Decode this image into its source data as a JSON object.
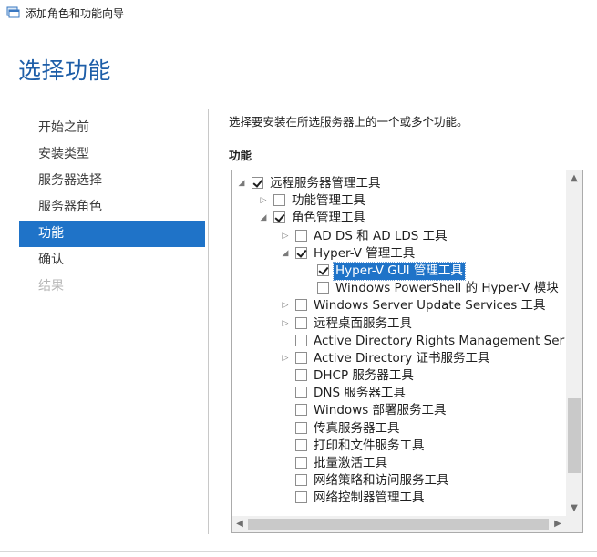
{
  "window": {
    "title": "添加角色和功能向导",
    "icon": "wizard-app-icon"
  },
  "page_title": "选择功能",
  "nav": {
    "items": [
      {
        "label": "开始之前",
        "state": "normal"
      },
      {
        "label": "安装类型",
        "state": "normal"
      },
      {
        "label": "服务器选择",
        "state": "normal"
      },
      {
        "label": "服务器角色",
        "state": "normal"
      },
      {
        "label": "功能",
        "state": "selected"
      },
      {
        "label": "确认",
        "state": "normal"
      },
      {
        "label": "结果",
        "state": "disabled"
      }
    ]
  },
  "main": {
    "description": "选择要安装在所选服务器上的一个或多个功能。",
    "section_label": "功能",
    "tree": [
      {
        "label": "远程服务器管理工具",
        "level": 0,
        "expander": "expanded",
        "checked": true,
        "highlighted": false
      },
      {
        "label": "功能管理工具",
        "level": 1,
        "expander": "collapsed",
        "checked": false,
        "highlighted": false
      },
      {
        "label": "角色管理工具",
        "level": 1,
        "expander": "expanded",
        "checked": true,
        "highlighted": false
      },
      {
        "label": "AD DS 和 AD LDS 工具",
        "level": 2,
        "expander": "collapsed",
        "checked": false,
        "highlighted": false
      },
      {
        "label": "Hyper-V 管理工具",
        "level": 2,
        "expander": "expanded",
        "checked": true,
        "highlighted": false
      },
      {
        "label": "Hyper-V GUI 管理工具",
        "level": 3,
        "expander": "none",
        "checked": true,
        "highlighted": true
      },
      {
        "label": "Windows PowerShell 的 Hyper-V 模块",
        "level": 3,
        "expander": "none",
        "checked": false,
        "highlighted": false
      },
      {
        "label": "Windows Server Update Services 工具",
        "level": 2,
        "expander": "collapsed",
        "checked": false,
        "highlighted": false
      },
      {
        "label": "远程桌面服务工具",
        "level": 2,
        "expander": "collapsed",
        "checked": false,
        "highlighted": false
      },
      {
        "label": "Active Directory Rights Management Services 工具",
        "level": 2,
        "expander": "none",
        "checked": false,
        "highlighted": false
      },
      {
        "label": "Active Directory 证书服务工具",
        "level": 2,
        "expander": "collapsed",
        "checked": false,
        "highlighted": false
      },
      {
        "label": "DHCP 服务器工具",
        "level": 2,
        "expander": "none",
        "checked": false,
        "highlighted": false
      },
      {
        "label": "DNS 服务器工具",
        "level": 2,
        "expander": "none",
        "checked": false,
        "highlighted": false
      },
      {
        "label": "Windows 部署服务工具",
        "level": 2,
        "expander": "none",
        "checked": false,
        "highlighted": false
      },
      {
        "label": "传真服务器工具",
        "level": 2,
        "expander": "none",
        "checked": false,
        "highlighted": false
      },
      {
        "label": "打印和文件服务工具",
        "level": 2,
        "expander": "none",
        "checked": false,
        "highlighted": false
      },
      {
        "label": "批量激活工具",
        "level": 2,
        "expander": "none",
        "checked": false,
        "highlighted": false
      },
      {
        "label": "网络策略和访问服务工具",
        "level": 2,
        "expander": "none",
        "checked": false,
        "highlighted": false
      },
      {
        "label": "网络控制器管理工具",
        "level": 2,
        "expander": "none",
        "checked": false,
        "highlighted": false
      }
    ]
  },
  "colors": {
    "accent": "#1f73c8",
    "title": "#1e5ea8",
    "disabled": "#b6b6b6"
  }
}
